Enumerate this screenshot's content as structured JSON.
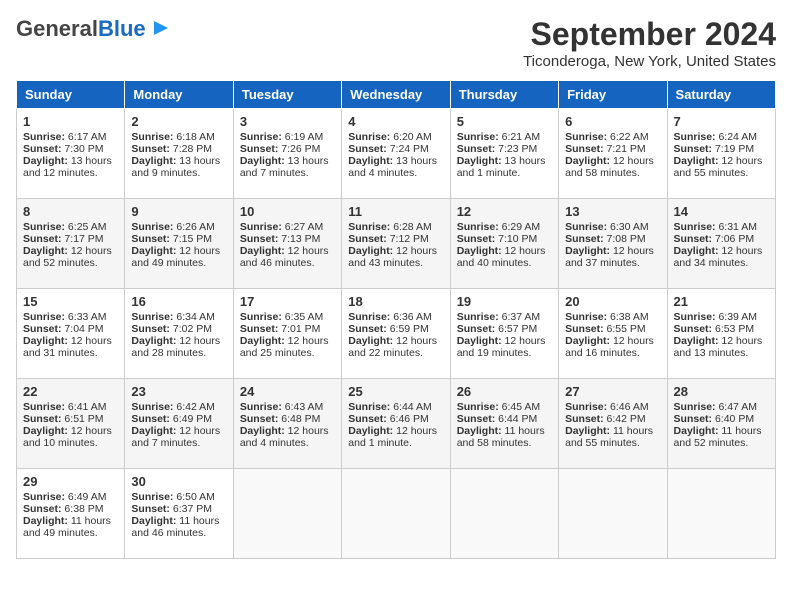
{
  "header": {
    "logo_general": "General",
    "logo_blue": "Blue",
    "title": "September 2024",
    "subtitle": "Ticonderoga, New York, United States"
  },
  "weekdays": [
    "Sunday",
    "Monday",
    "Tuesday",
    "Wednesday",
    "Thursday",
    "Friday",
    "Saturday"
  ],
  "weeks": [
    [
      {
        "day": "1",
        "info": "Sunrise: 6:17 AM\nSunset: 7:30 PM\nDaylight: 13 hours and 12 minutes."
      },
      {
        "day": "2",
        "info": "Sunrise: 6:18 AM\nSunset: 7:28 PM\nDaylight: 13 hours and 9 minutes."
      },
      {
        "day": "3",
        "info": "Sunrise: 6:19 AM\nSunset: 7:26 PM\nDaylight: 13 hours and 7 minutes."
      },
      {
        "day": "4",
        "info": "Sunrise: 6:20 AM\nSunset: 7:24 PM\nDaylight: 13 hours and 4 minutes."
      },
      {
        "day": "5",
        "info": "Sunrise: 6:21 AM\nSunset: 7:23 PM\nDaylight: 13 hours and 1 minute."
      },
      {
        "day": "6",
        "info": "Sunrise: 6:22 AM\nSunset: 7:21 PM\nDaylight: 12 hours and 58 minutes."
      },
      {
        "day": "7",
        "info": "Sunrise: 6:24 AM\nSunset: 7:19 PM\nDaylight: 12 hours and 55 minutes."
      }
    ],
    [
      {
        "day": "8",
        "info": "Sunrise: 6:25 AM\nSunset: 7:17 PM\nDaylight: 12 hours and 52 minutes."
      },
      {
        "day": "9",
        "info": "Sunrise: 6:26 AM\nSunset: 7:15 PM\nDaylight: 12 hours and 49 minutes."
      },
      {
        "day": "10",
        "info": "Sunrise: 6:27 AM\nSunset: 7:13 PM\nDaylight: 12 hours and 46 minutes."
      },
      {
        "day": "11",
        "info": "Sunrise: 6:28 AM\nSunset: 7:12 PM\nDaylight: 12 hours and 43 minutes."
      },
      {
        "day": "12",
        "info": "Sunrise: 6:29 AM\nSunset: 7:10 PM\nDaylight: 12 hours and 40 minutes."
      },
      {
        "day": "13",
        "info": "Sunrise: 6:30 AM\nSunset: 7:08 PM\nDaylight: 12 hours and 37 minutes."
      },
      {
        "day": "14",
        "info": "Sunrise: 6:31 AM\nSunset: 7:06 PM\nDaylight: 12 hours and 34 minutes."
      }
    ],
    [
      {
        "day": "15",
        "info": "Sunrise: 6:33 AM\nSunset: 7:04 PM\nDaylight: 12 hours and 31 minutes."
      },
      {
        "day": "16",
        "info": "Sunrise: 6:34 AM\nSunset: 7:02 PM\nDaylight: 12 hours and 28 minutes."
      },
      {
        "day": "17",
        "info": "Sunrise: 6:35 AM\nSunset: 7:01 PM\nDaylight: 12 hours and 25 minutes."
      },
      {
        "day": "18",
        "info": "Sunrise: 6:36 AM\nSunset: 6:59 PM\nDaylight: 12 hours and 22 minutes."
      },
      {
        "day": "19",
        "info": "Sunrise: 6:37 AM\nSunset: 6:57 PM\nDaylight: 12 hours and 19 minutes."
      },
      {
        "day": "20",
        "info": "Sunrise: 6:38 AM\nSunset: 6:55 PM\nDaylight: 12 hours and 16 minutes."
      },
      {
        "day": "21",
        "info": "Sunrise: 6:39 AM\nSunset: 6:53 PM\nDaylight: 12 hours and 13 minutes."
      }
    ],
    [
      {
        "day": "22",
        "info": "Sunrise: 6:41 AM\nSunset: 6:51 PM\nDaylight: 12 hours and 10 minutes."
      },
      {
        "day": "23",
        "info": "Sunrise: 6:42 AM\nSunset: 6:49 PM\nDaylight: 12 hours and 7 minutes."
      },
      {
        "day": "24",
        "info": "Sunrise: 6:43 AM\nSunset: 6:48 PM\nDaylight: 12 hours and 4 minutes."
      },
      {
        "day": "25",
        "info": "Sunrise: 6:44 AM\nSunset: 6:46 PM\nDaylight: 12 hours and 1 minute."
      },
      {
        "day": "26",
        "info": "Sunrise: 6:45 AM\nSunset: 6:44 PM\nDaylight: 11 hours and 58 minutes."
      },
      {
        "day": "27",
        "info": "Sunrise: 6:46 AM\nSunset: 6:42 PM\nDaylight: 11 hours and 55 minutes."
      },
      {
        "day": "28",
        "info": "Sunrise: 6:47 AM\nSunset: 6:40 PM\nDaylight: 11 hours and 52 minutes."
      }
    ],
    [
      {
        "day": "29",
        "info": "Sunrise: 6:49 AM\nSunset: 6:38 PM\nDaylight: 11 hours and 49 minutes."
      },
      {
        "day": "30",
        "info": "Sunrise: 6:50 AM\nSunset: 6:37 PM\nDaylight: 11 hours and 46 minutes."
      },
      {
        "day": "",
        "info": ""
      },
      {
        "day": "",
        "info": ""
      },
      {
        "day": "",
        "info": ""
      },
      {
        "day": "",
        "info": ""
      },
      {
        "day": "",
        "info": ""
      }
    ]
  ]
}
